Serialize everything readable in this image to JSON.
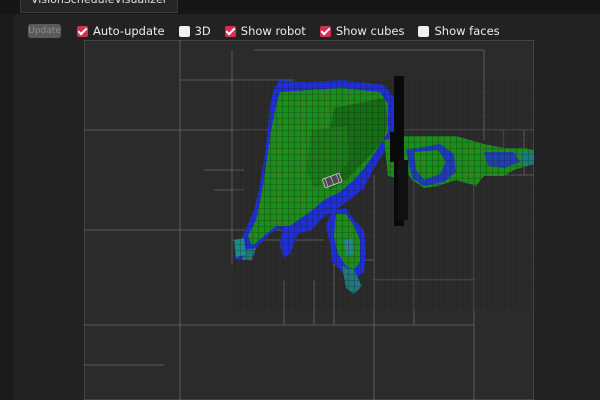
{
  "tab": {
    "label": "VisionScheduleVisualizer"
  },
  "toolbar": {
    "update_label": "Update",
    "checkboxes": [
      {
        "label": "Auto-update",
        "checked": true
      },
      {
        "label": "3D",
        "checked": false
      },
      {
        "label": "Show robot",
        "checked": true
      },
      {
        "label": "Show cubes",
        "checked": true
      },
      {
        "label": "Show faces",
        "checked": false
      }
    ]
  },
  "colors": {
    "accent": "#d4314e",
    "map_free": "#1a8e1a",
    "map_obstacle": "#1f2ce0",
    "map_unknown": "#1e7a7a"
  }
}
